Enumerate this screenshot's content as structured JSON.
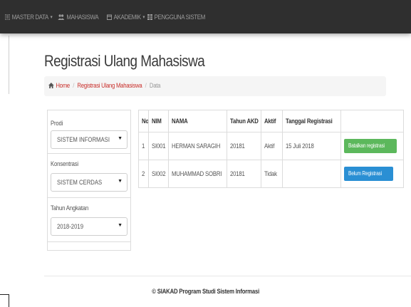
{
  "navbar": {
    "items": [
      {
        "label": "MASTER DATA",
        "icon": "list-icon",
        "has_caret": true
      },
      {
        "label": "MAHASISWA",
        "icon": "users-icon",
        "has_caret": false
      },
      {
        "label": "AKADEMIK",
        "icon": "calendar-icon",
        "has_caret": true
      },
      {
        "label": "PENGGUNA SISTEM",
        "icon": "table-icon",
        "has_caret": false
      }
    ],
    "background": "#2f2f2f"
  },
  "page": {
    "title": "Registrasi Ulang Mahasiswa"
  },
  "breadcrumb": {
    "home": "Home",
    "section": "Registrasi Ulang Mahasiswa",
    "current": "Data",
    "separator": "/"
  },
  "filters": {
    "prodi": {
      "label": "Prodi",
      "value": "SISTEM INFORMASI"
    },
    "konsentrasi": {
      "label": "Konsentrasi",
      "value": "SISTEM CERDAS"
    },
    "tahun": {
      "label": "Tahun Angkatan",
      "value": "2018-2019"
    }
  },
  "table": {
    "headers": [
      "No",
      "NIM",
      "NAMA",
      "Tahun AKD",
      "Aktif",
      "Tanggal Registrasi",
      ""
    ],
    "rows": [
      {
        "no": "1",
        "nim": "SI001",
        "nama": "HERMAN SARAGIH",
        "tahun": "20181",
        "aktif": "Aktif",
        "tanggal": "15 Juli 2018",
        "action": "Batalkan registrasi",
        "action_color": "#5cb85c"
      },
      {
        "no": "2",
        "nim": "SI002",
        "nama": "MUHAMMAD SOBRI",
        "tahun": "20181",
        "aktif": "Tidak",
        "tanggal": "",
        "action": "Belum Registrasi",
        "action_color": "#2a8fd4"
      }
    ]
  },
  "footer": {
    "text": "© SIAKAD Program Studi Sistem Informasi"
  },
  "colors": {
    "link": "#c9302c",
    "success": "#5cb85c",
    "primary": "#2a8fd4"
  }
}
